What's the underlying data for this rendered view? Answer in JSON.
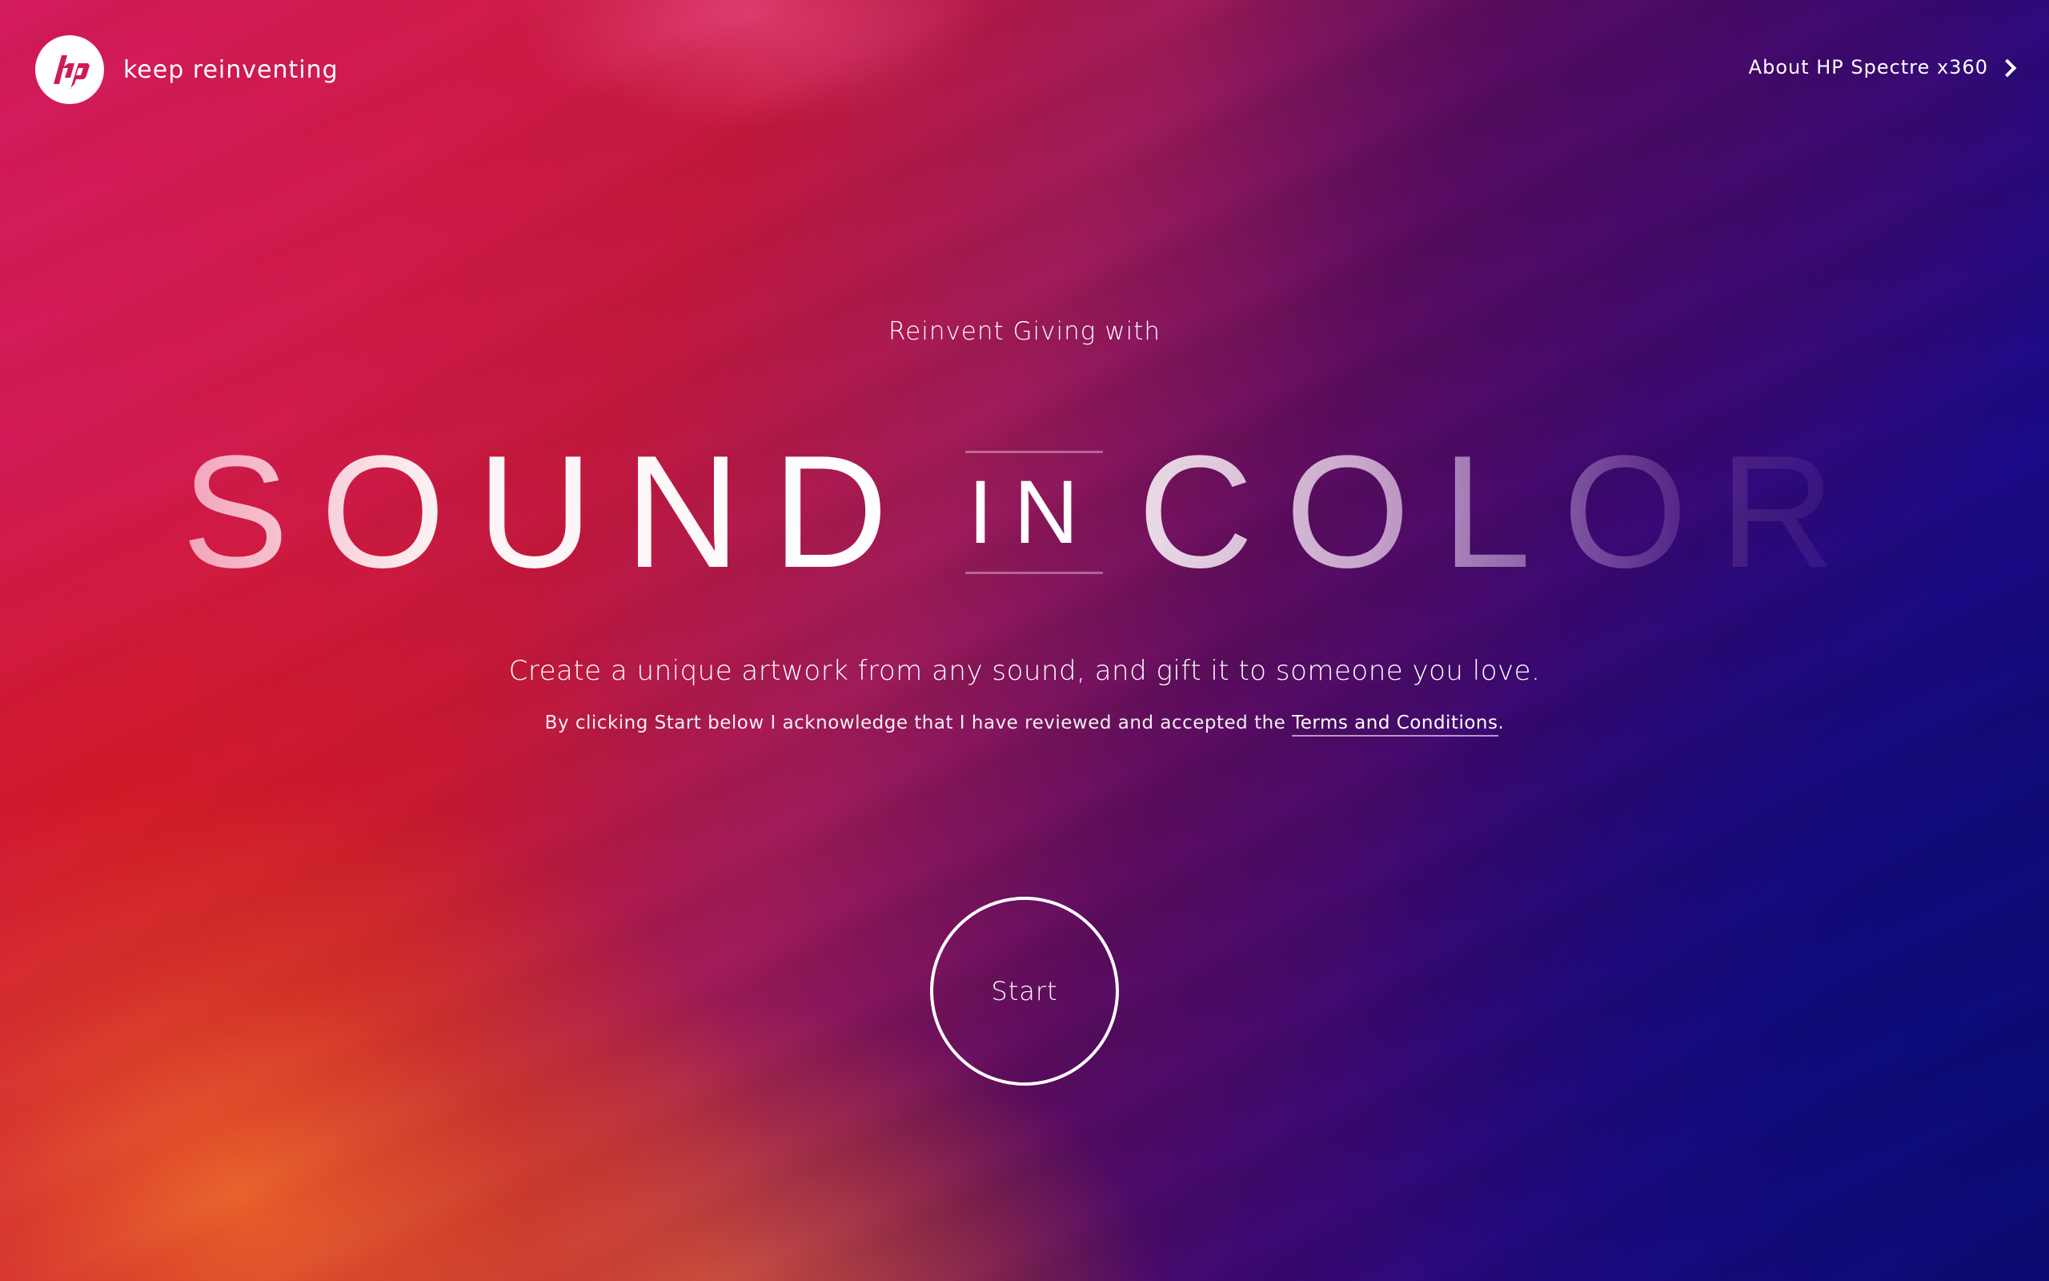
{
  "header": {
    "logo_text": "hp",
    "tagline": "keep reinventing",
    "about_link": "About HP Spectre x360"
  },
  "hero": {
    "intro": "Reinvent Giving with",
    "headline": {
      "word1": "SOUND",
      "word2": "IN",
      "word3": "COLOR"
    },
    "description": "Create a unique artwork from any sound, and gift it to someone you love.",
    "disclaimer_prefix": "By clicking Start below I acknowledge that I have reviewed and accepted the ",
    "terms_link": "Terms and Conditions",
    "disclaimer_suffix": ".",
    "start_button": "Start"
  },
  "icons": {
    "logo": "hp-logo-icon",
    "about_arrow": "chevron-right-icon"
  },
  "colors": {
    "text": "#ffffff",
    "bg_warm": "#d21a5c",
    "bg_red": "#c2183c",
    "bg_purple": "#5a0c5e",
    "bg_blue": "#1c0a86"
  }
}
